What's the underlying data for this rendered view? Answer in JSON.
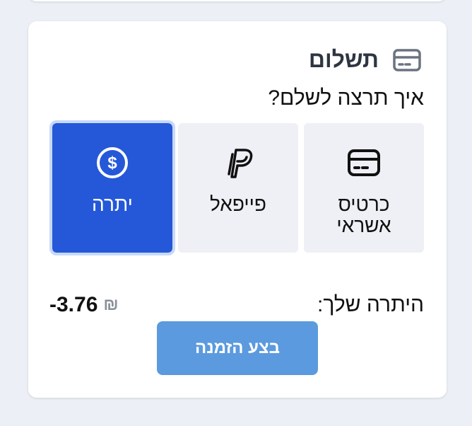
{
  "payment": {
    "title": "תשלום",
    "title_icon": "credit-card-icon",
    "question": "איך תרצה לשלם?",
    "options": [
      {
        "id": "credit_card",
        "label": "כרטיס אשראי",
        "icon": "credit-card-icon",
        "selected": false
      },
      {
        "id": "paypal",
        "label": "פייפאל",
        "icon": "paypal-icon",
        "selected": false
      },
      {
        "id": "balance",
        "label": "יתרה",
        "icon": "dollar-circle-icon",
        "selected": true
      }
    ],
    "balance_label": "היתרה שלך:",
    "balance_amount": "-3.76",
    "currency_symbol": "₪",
    "submit_label": "בצע הזמנה"
  },
  "colors": {
    "selected_bg": "#2458d8",
    "option_bg": "#eef0f5",
    "submit_bg": "#5b9ade"
  }
}
